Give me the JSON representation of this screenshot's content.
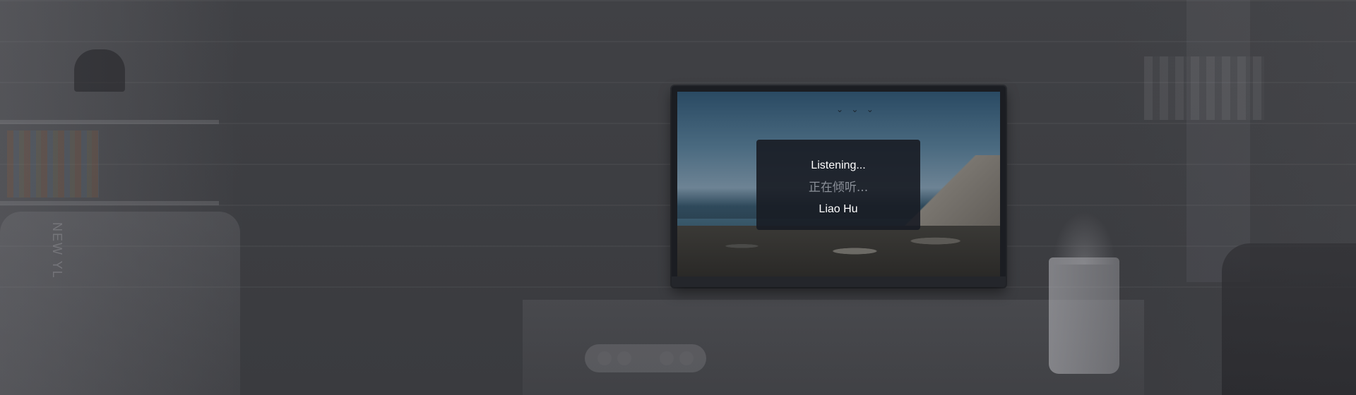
{
  "voice_dialog": {
    "status": "Listening...",
    "status_cn": "正在倾听...",
    "user": "Liao Hu"
  },
  "decor": {
    "wall_text": "NEW YL"
  },
  "colors": {
    "background": "#3d3e42",
    "dialog_bg": "#181c24",
    "dialog_text": "#ffffff",
    "dialog_secondary_text": "#8a8f98"
  }
}
